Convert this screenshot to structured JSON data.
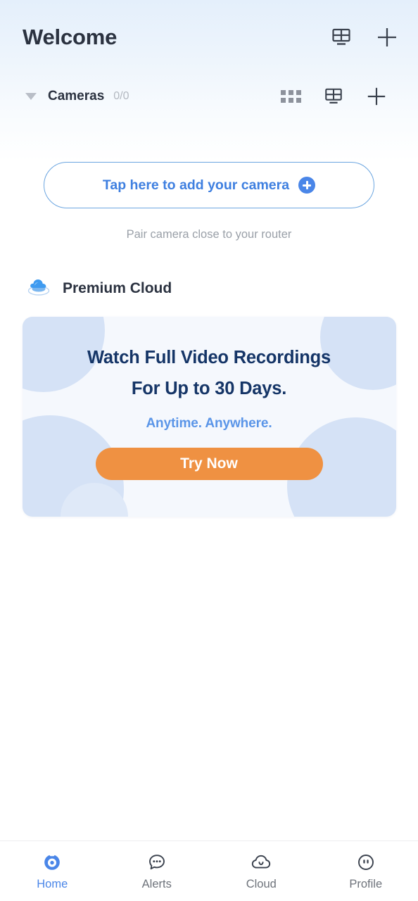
{
  "header": {
    "title": "Welcome",
    "grid_icon": "grid-view-icon",
    "add_icon": "plus-icon"
  },
  "cameras_section": {
    "caret_icon": "chevron-down-icon",
    "label": "Cameras",
    "count": "0/0",
    "dots_icon": "dots-grid-icon",
    "grid_icon": "grid-view-icon",
    "add_icon": "plus-icon"
  },
  "add_camera": {
    "label": "Tap here to add your camera",
    "plus_icon": "plus-circle-icon",
    "hint": "Pair camera close to your router"
  },
  "premium": {
    "icon": "cloud-3d-icon",
    "label": "Premium Cloud"
  },
  "promo": {
    "title_line1": "Watch Full Video Recordings",
    "title_line2": "For Up to 30 Days.",
    "subtitle": "Anytime. Anywhere.",
    "cta_label": "Try Now"
  },
  "bottom_nav": {
    "items": [
      {
        "label": "Home",
        "icon": "camera-lens-icon",
        "active": true
      },
      {
        "label": "Alerts",
        "icon": "chat-bubble-icon",
        "active": false
      },
      {
        "label": "Cloud",
        "icon": "cloud-smile-icon",
        "active": false
      },
      {
        "label": "Profile",
        "icon": "face-circle-icon",
        "active": false
      }
    ]
  },
  "colors": {
    "accent_blue": "#4a86e8",
    "title_navy": "#153567",
    "cta_orange": "#ef9142",
    "text_dark": "#2b3240",
    "muted_gray": "#9aa0a8",
    "card_bg": "#f5f8fd",
    "blob_blue": "#d5e2f6"
  }
}
